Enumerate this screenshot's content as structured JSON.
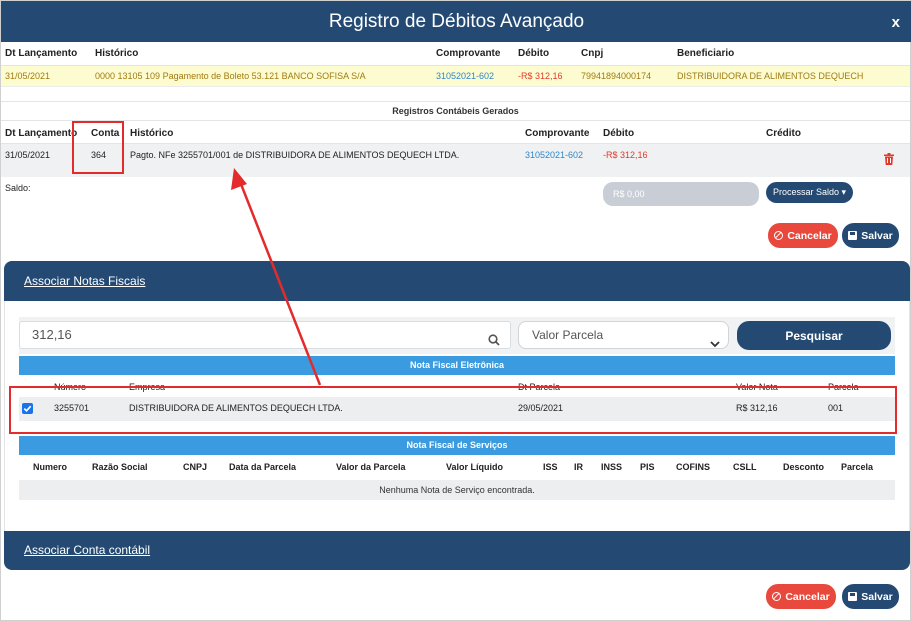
{
  "modal": {
    "title": "Registro de Débitos Avançado",
    "close": "x"
  },
  "debit": {
    "headers": [
      "Dt Lançamento",
      "Histórico",
      "Comprovante",
      "Débito",
      "Cnpj",
      "Beneficiario"
    ],
    "row": {
      "date": "31/05/2021",
      "historico": "0000 13105 109 Pagamento de Boleto 53.121 BANCO SOFISA S/A",
      "comprovante": "31052021-602",
      "debito": "-R$ 312,16",
      "cnpj": "79941894000174",
      "beneficiario": "DISTRIBUIDORA DE ALIMENTOS DEQUECH"
    }
  },
  "registros": {
    "title": "Registros Contábeis Gerados",
    "headers": [
      "Dt Lançamento",
      "Conta",
      "Histórico",
      "Comprovante",
      "Débito",
      "Crédito"
    ],
    "row": {
      "date": "31/05/2021",
      "conta": "364",
      "historico": "Pagto. NFe 3255701/001 de DISTRIBUIDORA DE ALIMENTOS DEQUECH LTDA.",
      "comprovante": "31052021-602",
      "debito": "-R$ 312,16"
    },
    "saldo_label": "Saldo:",
    "saldo_value": "R$ 0,00",
    "processar_label": "Processar Saldo ▾"
  },
  "actions": {
    "cancel_label": "Cancelar",
    "save_label": "Salvar"
  },
  "associar_notas": {
    "title": "Associar Notas Fiscais",
    "search_value": "312,16",
    "select_value": "Valor Parcela",
    "search_button": "Pesquisar",
    "nfe": {
      "band": "Nota Fiscal Eletrônica",
      "headers": [
        "Número",
        "Empresa",
        "Dt Parcela",
        "Valor Nota",
        "Parcela"
      ],
      "row": {
        "numero": "3255701",
        "empresa": "DISTRIBUIDORA DE ALIMENTOS DEQUECH LTDA.",
        "dt_parcela": "29/05/2021",
        "valor": "R$ 312,16",
        "parcela": "001"
      }
    },
    "nfs": {
      "band": "Nota Fiscal de Serviços",
      "headers": [
        "Numero",
        "Razão Social",
        "CNPJ",
        "Data da Parcela",
        "Valor da Parcela",
        "Valor Líquido",
        "ISS",
        "IR",
        "INSS",
        "PIS",
        "COFINS",
        "CSLL",
        "Desconto",
        "Parcela"
      ],
      "empty": "Nenhuma Nota de Serviço encontrada."
    }
  },
  "associar_conta": {
    "title": "Associar Conta contábil"
  },
  "colors": {
    "navy": "#244a73",
    "band_blue": "#3b9be0",
    "red": "#e8493c",
    "highlight": "#fdfcd0",
    "annotation_red": "#e32b2b"
  },
  "icons": [
    "close-icon",
    "trash-icon",
    "search-icon",
    "chevron-down-icon",
    "ban-icon",
    "save-icon",
    "checkbox-checked-icon"
  ]
}
